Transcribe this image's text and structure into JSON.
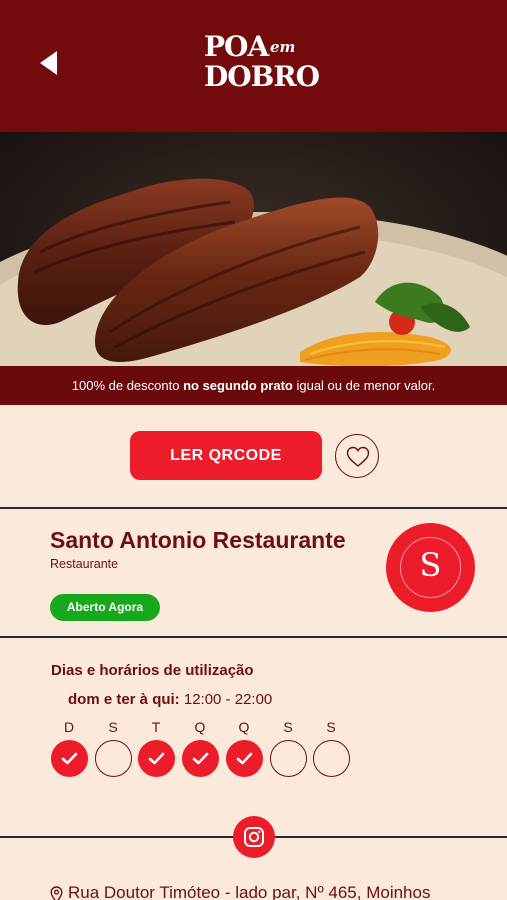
{
  "header": {
    "logo_line1": "POA",
    "logo_line2": "em",
    "logo_line3": "DOBRO"
  },
  "promo": {
    "caption_pre": "100% de desconto ",
    "caption_bold": "no segundo prato",
    "caption_post": " igual ou de menor valor."
  },
  "actions": {
    "qrcode_label": "LER QRCODE"
  },
  "restaurant": {
    "name": "Santo Antonio Restaurante",
    "category": "Restaurante",
    "status": "Aberto Agora",
    "logo_monogram": "S"
  },
  "schedule": {
    "title": "Dias e horários de utilização",
    "days_label": "dom e ter à qui:",
    "hours": " 12:00 - 22:00",
    "days": [
      {
        "letter": "D",
        "active": true
      },
      {
        "letter": "S",
        "active": false
      },
      {
        "letter": "T",
        "active": true
      },
      {
        "letter": "Q",
        "active": true
      },
      {
        "letter": "Q",
        "active": true
      },
      {
        "letter": "S",
        "active": false
      },
      {
        "letter": "S",
        "active": false
      }
    ]
  },
  "address": {
    "text": "Rua Doutor Timóteo - lado par, Nº 465, Moinhos"
  },
  "colors": {
    "header_bg": "#730a0c",
    "accent_red": "#ec1c2b",
    "text_maroon": "#6b0f12",
    "open_green": "#17a81d",
    "page_bg": "#fbe9dc"
  },
  "icons": {
    "back": "back-arrow-icon",
    "favorite": "heart-icon",
    "check": "check-icon",
    "social": "instagram-icon",
    "location": "map-pin-icon"
  }
}
